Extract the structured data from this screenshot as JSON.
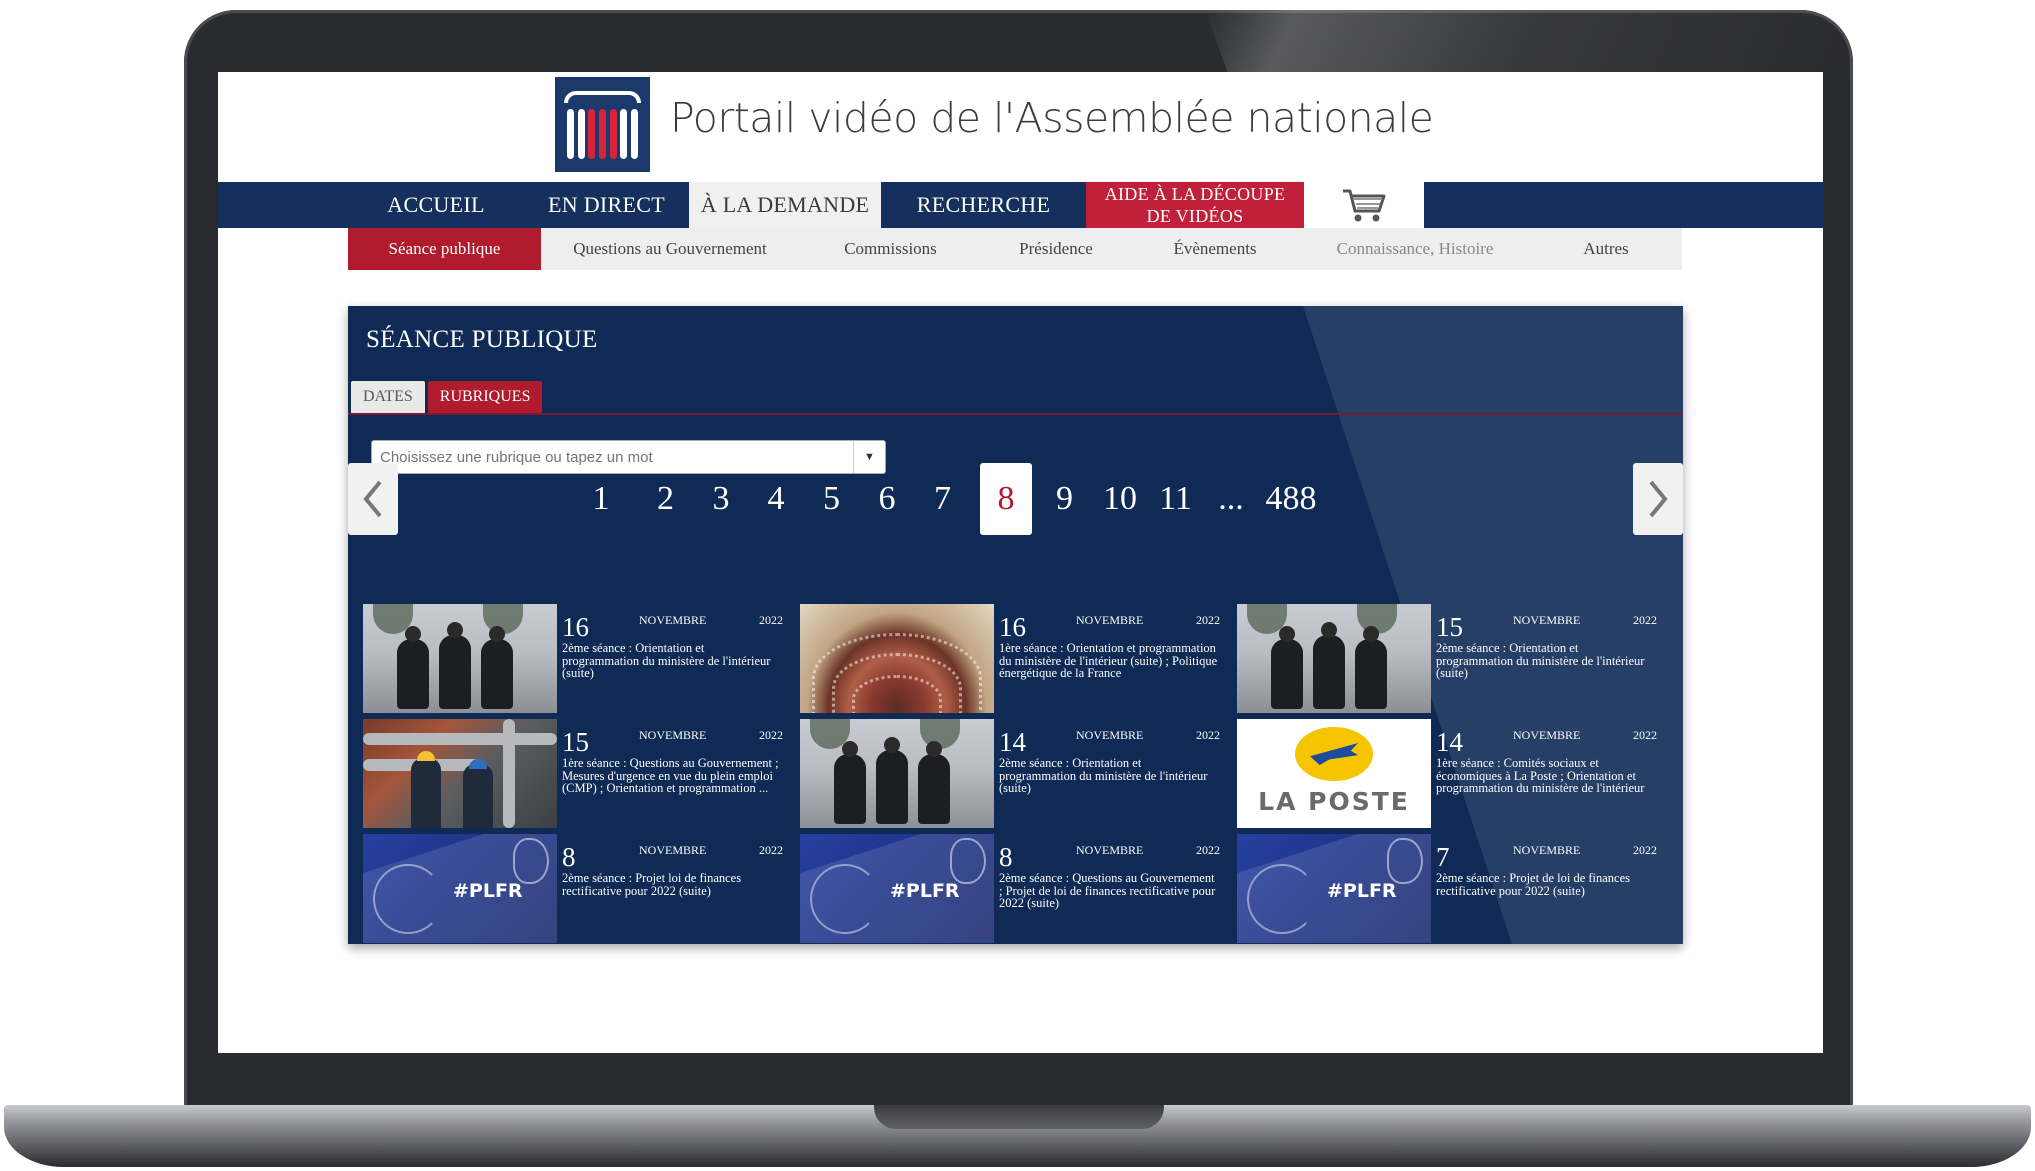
{
  "site": {
    "title": "Portail vidéo de l'Assemblée nationale"
  },
  "main_nav": {
    "items": [
      {
        "label": "ACCUEIL"
      },
      {
        "label": "EN DIRECT"
      },
      {
        "label": "À LA DEMANDE"
      },
      {
        "label": "RECHERCHE"
      }
    ],
    "help_line1": "AIDE À LA DÉCOUPE",
    "help_line2": "DE VIDÉOS",
    "active": "À LA DEMANDE"
  },
  "sub_nav": {
    "items": [
      {
        "label": "Séance publique"
      },
      {
        "label": "Questions au Gouvernement"
      },
      {
        "label": "Commissions"
      },
      {
        "label": "Présidence"
      },
      {
        "label": "Évènements"
      },
      {
        "label": "Connaissance, Histoire"
      },
      {
        "label": "Autres"
      }
    ],
    "active": "Séance publique"
  },
  "panel": {
    "title": "SÉANCE PUBLIQUE",
    "tabs": [
      {
        "label": "DATES"
      },
      {
        "label": "RUBRIQUES"
      }
    ],
    "active_tab": "RUBRIQUES",
    "select_placeholder": "Choisissez une rubrique ou tapez un mot"
  },
  "pagination": {
    "pages": [
      "1",
      "2",
      "3",
      "4",
      "5",
      "6",
      "7",
      "8",
      "9",
      "10",
      "11",
      "...",
      "488"
    ],
    "current": "8"
  },
  "videos": [
    {
      "day": "16",
      "month": "NOVEMBRE",
      "year": "2022",
      "title": "2ème séance : Orientation et programmation du ministère de l'intérieur (suite)",
      "thumb": "police"
    },
    {
      "day": "16",
      "month": "NOVEMBRE",
      "year": "2022",
      "title": "1ère séance : Orientation et programmation du ministère de l'intérieur (suite) ; Politique énergétique de la France",
      "thumb": "hemicycle"
    },
    {
      "day": "15",
      "month": "NOVEMBRE",
      "year": "2022",
      "title": "2ème séance : Orientation et programmation du ministère de l'intérieur (suite)",
      "thumb": "police"
    },
    {
      "day": "15",
      "month": "NOVEMBRE",
      "year": "2022",
      "title": "1ère séance : Questions au Gouvernement ; Mesures d'urgence en vue du plein emploi (CMP) ; Orientation et programmation ...",
      "thumb": "industry"
    },
    {
      "day": "14",
      "month": "NOVEMBRE",
      "year": "2022",
      "title": "2ème séance : Orientation et programmation du ministère de l'intérieur (suite)",
      "thumb": "police"
    },
    {
      "day": "14",
      "month": "NOVEMBRE",
      "year": "2022",
      "title": "1ère séance : Comités sociaux et économiques à La Poste ; Orientation et programmation du ministère de l'intérieur",
      "thumb": "laposte",
      "logo_text": "LA POSTE"
    },
    {
      "day": "8",
      "month": "NOVEMBRE",
      "year": "2022",
      "title": "2ème séance : Projet loi de finances rectificative pour 2022 (suite)",
      "thumb": "plfr",
      "logo_text": "#PLFR"
    },
    {
      "day": "8",
      "month": "NOVEMBRE",
      "year": "2022",
      "title": "2ème séance : Questions au Gouvernement ; Projet de loi de finances rectificative pour 2022 (suite)",
      "thumb": "plfr",
      "logo_text": "#PLFR"
    },
    {
      "day": "7",
      "month": "NOVEMBRE",
      "year": "2022",
      "title": "2ème séance : Projet de loi de finances rectificative pour 2022 (suite)",
      "thumb": "plfr",
      "logo_text": "#PLFR"
    }
  ],
  "colors": {
    "navy": "#15305c",
    "panel": "#0e2a55",
    "accent_red": "#b01c2e"
  }
}
